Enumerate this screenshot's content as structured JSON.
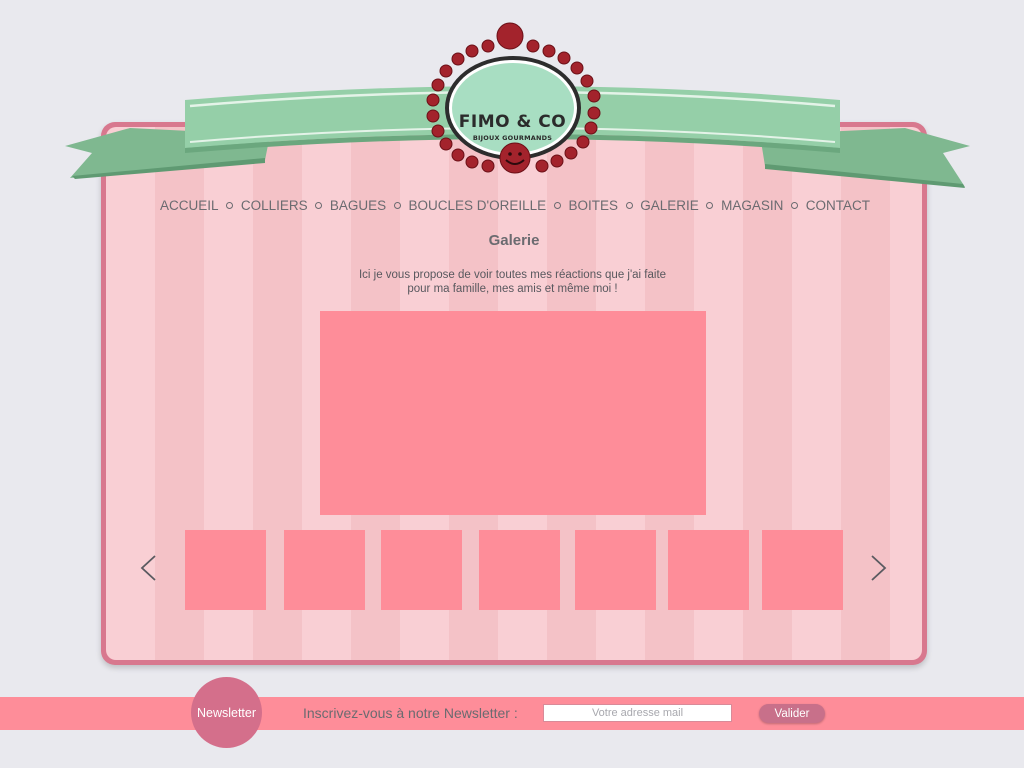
{
  "brand": {
    "name": "FIMO & CO",
    "tagline": "BIJOUX GOURMANDS"
  },
  "nav": {
    "items": [
      "ACCUEIL",
      "COLLIERS",
      "BAGUES",
      "BOUCLES D'OREILLE",
      "BOITES",
      "GALERIE",
      "MAGASIN",
      "CONTACT"
    ]
  },
  "page": {
    "title": "Galerie",
    "intro_line1": "Ici je vous propose de voir toutes mes réactions que j'ai faite",
    "intro_line2": "pour ma famille, mes amis et même moi !"
  },
  "gallery": {
    "thumbnail_count": 7,
    "prev_icon": "chevron-left-icon",
    "next_icon": "chevron-right-icon"
  },
  "newsletter": {
    "badge": "Newsletter",
    "label": "Inscrivez-vous à notre Newsletter :",
    "input_placeholder": "Votre adresse mail",
    "button": "Valider"
  },
  "colors": {
    "background": "#e9e9ee",
    "card_border": "#d8788e",
    "stripe_light": "#f9cfd4",
    "stripe_dark": "#f4c2c7",
    "image_placeholder": "#fe8d99",
    "ribbon": "#8ec9a3",
    "bead": "#a3232c",
    "accent": "#d46f8b",
    "text": "#6b6b70"
  }
}
